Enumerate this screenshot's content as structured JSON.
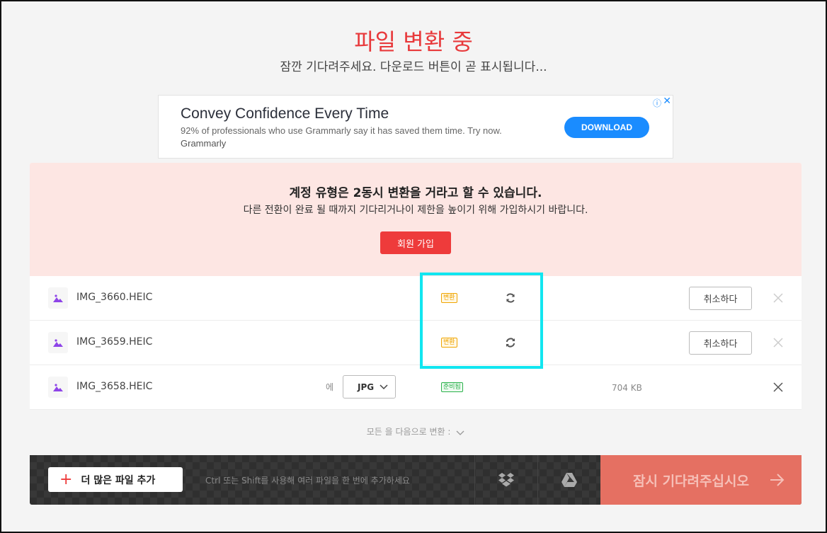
{
  "header": {
    "title": "파일 변환 중",
    "subtitle": "잠깐 기다려주세요. 다운로드 버튼이 곧 표시됩니다..."
  },
  "ad": {
    "headline": "Convey Confidence Every Time",
    "body": "92% of professionals who use Grammarly say it has saved them time. Try now.",
    "brand": "Grammarly",
    "cta": "DOWNLOAD",
    "info_icon": "ⓘ",
    "close_icon": "✕"
  },
  "notice": {
    "title": "계정 유형은 2동시 변환을 거라고 할 수 있습니다.",
    "text": "다른 전환이 완료 될 때까지 기다리거나이 제한을 높이기 위해 가입하시기 바랍니다.",
    "signup_label": "회원 가입"
  },
  "files": [
    {
      "name": "IMG_3660.HEIC",
      "status": "변환",
      "cancel_label": "취소하다"
    },
    {
      "name": "IMG_3659.HEIC",
      "status": "변환",
      "cancel_label": "취소하다"
    },
    {
      "name": "IMG_3658.HEIC",
      "to_label": "에",
      "format": "JPG",
      "status": "준비됨",
      "size": "704 KB"
    }
  ],
  "convert_all": "모든 을 다음으로 변환 :",
  "bottom_bar": {
    "add_label": "더 많은 파일 추가",
    "hint": "Ctrl 또는 Shift를 사용해 여러 파일을 한 번에 추가하세요",
    "wait_label": "잠시 기다려주십시오"
  },
  "colors": {
    "accent": "#e8393b",
    "highlight": "#11e6f0",
    "ad_cta": "#1a8cff",
    "wait_button": "#e57062"
  }
}
